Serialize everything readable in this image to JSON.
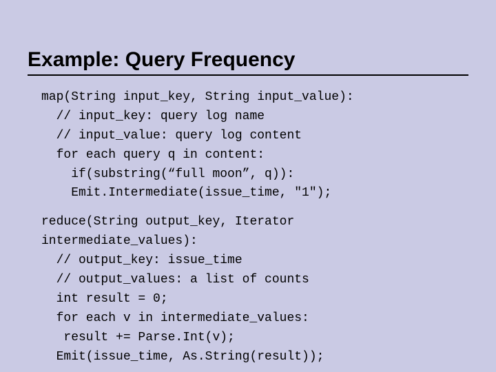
{
  "title": "Example: Query Frequency",
  "code": {
    "l01": "map(String input_key, String input_value):",
    "l02": "  // input_key: query log name",
    "l03": "  // input_value: query log content",
    "l04": "  for each query q in content:",
    "l05": "    if(substring(“full moon”, q)):",
    "l06": "    Emit.Intermediate(issue_time, \"1\");",
    "l07a": "reduce(String output_key, Iterator",
    "l07b": "intermediate_values):",
    "l08": "  // output_key: issue_time",
    "l09": "  // output_values: a list of counts",
    "l10": "  int result = 0;",
    "l11": "  for each v in intermediate_values:",
    "l12": "   result += Parse.Int(v);",
    "l13": "  Emit(issue_time, As.String(result));"
  }
}
